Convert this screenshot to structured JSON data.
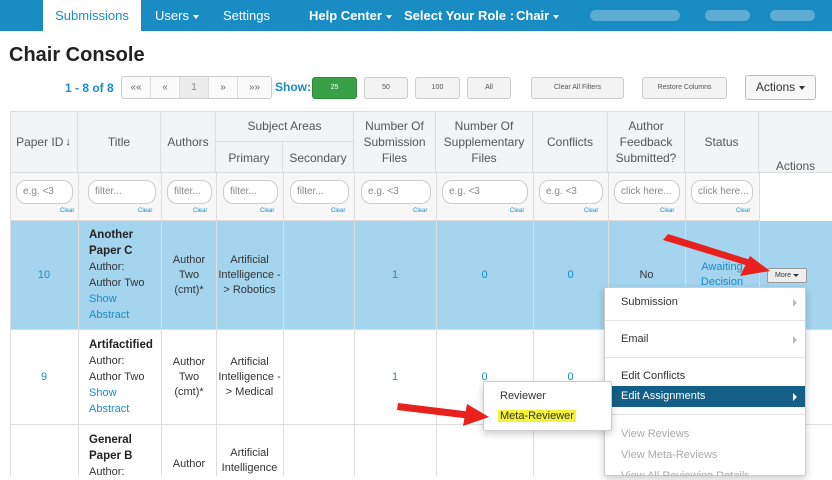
{
  "nav": {
    "submissions": "Submissions",
    "users": "Users",
    "settings": "Settings",
    "help_center": "Help Center",
    "select_role": "Select Your Role :",
    "role": "Chair"
  },
  "page": {
    "title": "Chair Console",
    "pager_text": "1 - 8 of 8",
    "pager_buttons": [
      "««",
      "«",
      "1",
      "»",
      "»»"
    ],
    "show_label": "Show:",
    "show_options": [
      "25",
      "50",
      "100",
      "All"
    ],
    "clear_filters": "Clear All Filters",
    "restore_columns": "Restore Columns",
    "actions": "Actions"
  },
  "table": {
    "headers": {
      "paper_id": "Paper ID",
      "sort_icon": "arrow-down-icon",
      "title": "Title",
      "authors": "Authors",
      "subject_areas": "Subject Areas",
      "primary": "Primary",
      "secondary": "Secondary",
      "num_submission": "Number Of Submission Files",
      "num_supplementary": "Number Of Supplementary Files",
      "conflicts": "Conflicts",
      "author_feedback": "Author Feedback Submitted?",
      "status": "Status",
      "actions": "Actions"
    },
    "filters": {
      "paper_id": "e.g. <3",
      "title": "filter...",
      "authors": "filter...",
      "primary": "filter...",
      "secondary": "filter...",
      "num_submission": "e.g. <3",
      "num_supplementary": "e.g. <3",
      "conflicts": "e.g. <3",
      "author_feedback": "click here...",
      "status": "click here...",
      "clear": "Clear"
    },
    "rows": [
      {
        "id": "10",
        "title": "Another Paper C",
        "author_line": "Author: Author Two",
        "show_abstract": "Show Abstract",
        "authors": "Author Two (cmt)*",
        "primary": "Artificial Intelligence -> Robotics",
        "num_submission": "1",
        "num_supplementary": "0",
        "conflicts": "0",
        "author_feedback": "No",
        "status": "Awaiting Decision",
        "more": "More"
      },
      {
        "id": "9",
        "title": "Artifactified",
        "author_line": "Author: Author Two",
        "show_abstract": "Show Abstract",
        "authors": "Author Two (cmt)*",
        "primary": "Artificial Intelligence -> Medical",
        "num_submission": "1",
        "num_supplementary": "0",
        "conflicts": "0"
      },
      {
        "title": "General Paper B",
        "author_line": "Author:",
        "authors": "Author",
        "primary": "Artificial Intelligence"
      }
    ]
  },
  "menu": {
    "submission": "Submission",
    "email": "Email",
    "edit_conflicts": "Edit Conflicts",
    "edit_assignments": "Edit Assignments",
    "view_reviews": "View Reviews",
    "view_meta_reviews": "View Meta-Reviews",
    "view_all_reviewing": "View All Reviewing Details"
  },
  "submenu": {
    "reviewer": "Reviewer",
    "meta_reviewer": "Meta-Reviewer"
  },
  "colors": {
    "nav_bg": "#1a8cc4",
    "selected_row": "#a4d4ee",
    "highlight": "#f5f23a",
    "annotation_arrow": "#e8211c"
  }
}
